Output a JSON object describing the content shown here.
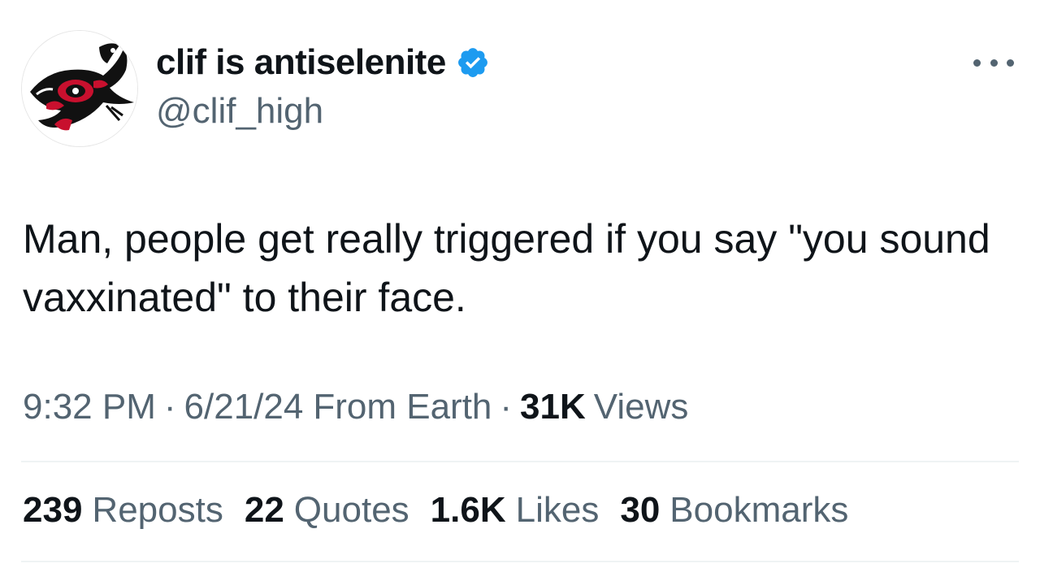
{
  "author": {
    "display_name": "clif is antiselenite",
    "handle": "@clif_high",
    "avatar_icon": "raven-formline-art-icon",
    "verified_icon": "verified-badge-icon"
  },
  "menu": {
    "icon": "more-options-icon"
  },
  "tweet": {
    "text": "Man, people get really triggered if you say \"you sound vaxxinated\" to their face."
  },
  "meta": {
    "time": "9:32 PM",
    "separator": "·",
    "date": "6/21/24",
    "source": "From Earth",
    "views_count": "31K",
    "views_label": "Views"
  },
  "stats": [
    {
      "count": "239",
      "label": "Reposts"
    },
    {
      "count": "22",
      "label": "Quotes"
    },
    {
      "count": "1.6K",
      "label": "Likes"
    },
    {
      "count": "30",
      "label": "Bookmarks"
    }
  ],
  "colors": {
    "text_primary": "#0f1419",
    "text_secondary": "#536471",
    "verified_blue": "#1d9bf0",
    "divider": "#eff3f4",
    "avatar_red": "#c8102e"
  }
}
